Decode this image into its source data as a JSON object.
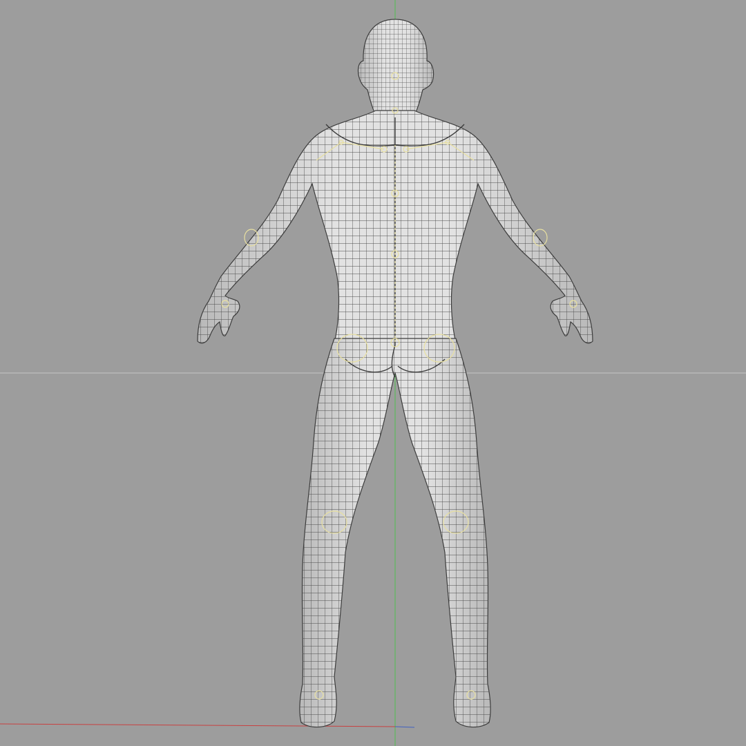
{
  "viewport": {
    "view": "back",
    "shading": "wireframe-on-shaded",
    "background_color": "#9d9d9d"
  },
  "colors": {
    "mesh_fill": "#d7d7d7",
    "mesh_wire": "#4a4a4a",
    "mesh_outline": "#3c3c3c",
    "rig_helper": "#e8e0a0",
    "axis_y": "#4fbf4f",
    "axis_x": "#c84040",
    "horizon": "#c8c8c8"
  },
  "model": {
    "type": "human-male-base-mesh",
    "pose": "a-pose"
  },
  "icons": {
    "grid_axis": "axis-lines",
    "rig": "joint-helpers"
  }
}
